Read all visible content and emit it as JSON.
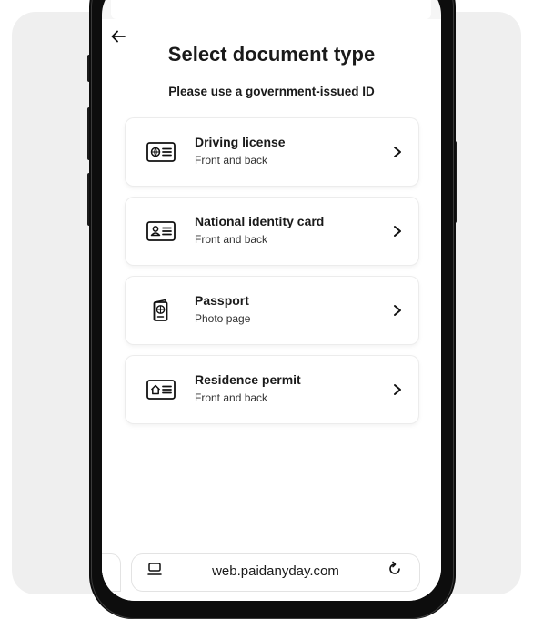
{
  "header": {
    "back_label": "←",
    "title": "Select document type",
    "subtitle": "Please use a government-issued ID"
  },
  "documents": [
    {
      "title": "Driving license",
      "description": "Front and back",
      "icon": "driving-license-icon"
    },
    {
      "title": "National identity card",
      "description": "Front and back",
      "icon": "id-card-icon"
    },
    {
      "title": "Passport",
      "description": "Photo page",
      "icon": "passport-icon"
    },
    {
      "title": "Residence permit",
      "description": "Front and back",
      "icon": "residence-permit-icon"
    }
  ],
  "browser": {
    "url": "web.paidanyday.com"
  },
  "colors": {
    "backdrop": "#efefef",
    "phone_body": "#0d0d0d",
    "text": "#1a1a1a"
  }
}
